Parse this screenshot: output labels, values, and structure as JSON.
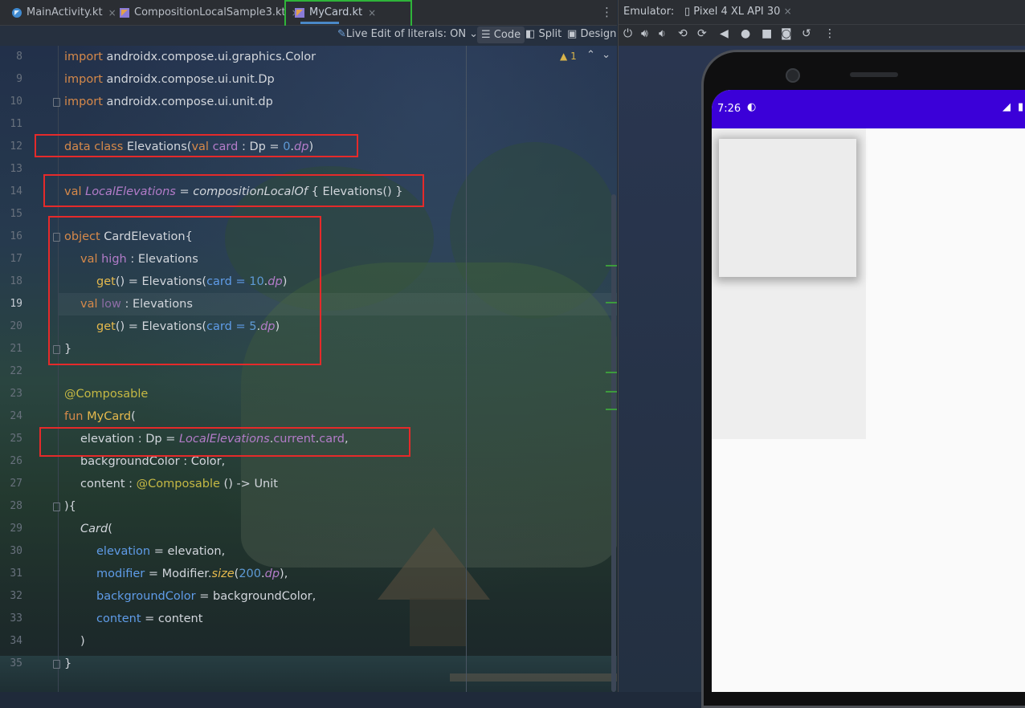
{
  "tabs": [
    {
      "label": "MainActivity.kt",
      "active": false
    },
    {
      "label": "CompositionLocalSample3.kt",
      "active": false
    },
    {
      "label": "MyCard.kt",
      "active": true
    }
  ],
  "editor_toolbar": {
    "live_edit": "Live Edit of literals: ON",
    "code": "Code",
    "split": "Split",
    "design": "Design"
  },
  "inspection": {
    "warning_count": "1"
  },
  "line_numbers": [
    "8",
    "9",
    "10",
    "11",
    "12",
    "13",
    "14",
    "15",
    "16",
    "17",
    "18",
    "19",
    "20",
    "21",
    "22",
    "23",
    "24",
    "25",
    "26",
    "27",
    "28",
    "29",
    "30",
    "31",
    "32",
    "33",
    "34",
    "35"
  ],
  "code": {
    "l8": [
      "import",
      " androidx.compose.ui.graphics.Color"
    ],
    "l9": [
      "import",
      " androidx.compose.ui.unit.Dp"
    ],
    "l10": [
      "import",
      " androidx.compose.ui.unit.dp"
    ],
    "l12": [
      "data class",
      " Elevations(",
      "val",
      " ",
      "card",
      " : Dp = ",
      "0",
      ".",
      "dp",
      ")"
    ],
    "l14": [
      "val",
      " ",
      "LocalElevations",
      " = ",
      "compositionLocalOf",
      " { Elevations() }"
    ],
    "l16": [
      "object",
      " CardElevation{"
    ],
    "l17": [
      "val",
      " ",
      "high",
      " : Elevations"
    ],
    "l18": [
      "get",
      "() = Elevations(",
      "card",
      " = ",
      "10",
      ".",
      "dp",
      ")"
    ],
    "l19": [
      "val",
      " ",
      "low",
      " : Elevations"
    ],
    "l20": [
      "get",
      "() = Elevations(",
      "card",
      " = ",
      "5",
      ".",
      "dp",
      ")"
    ],
    "l21": [
      "}"
    ],
    "l23": [
      "@Composable"
    ],
    "l24": [
      "fun",
      " ",
      "MyCard",
      "("
    ],
    "l25": [
      "elevation : Dp = ",
      "LocalElevations",
      ".",
      "current",
      ".",
      "card",
      ","
    ],
    "l26": [
      "backgroundColor : Color,"
    ],
    "l27": [
      "content : ",
      "@Composable",
      " () -> Unit"
    ],
    "l28": [
      "){"
    ],
    "l29": [
      "Card",
      "("
    ],
    "l30": [
      "elevation",
      " = elevation,"
    ],
    "l31": [
      "modifier",
      " = Modifier.",
      "size",
      "(",
      "200",
      ".",
      "dp",
      "),"
    ],
    "l32": [
      "backgroundColor",
      " = backgroundColor,"
    ],
    "l33": [
      "content",
      " = content"
    ],
    "l34": [
      ")"
    ],
    "l35": [
      "}"
    ]
  },
  "emulator": {
    "label": "Emulator:",
    "device": "Pixel 4 XL API 30",
    "status_time": "7:26"
  },
  "colors": {
    "status_bar": "#3b00d8",
    "highlight_red": "#e52a2a",
    "highlight_green": "#2fb43a"
  }
}
